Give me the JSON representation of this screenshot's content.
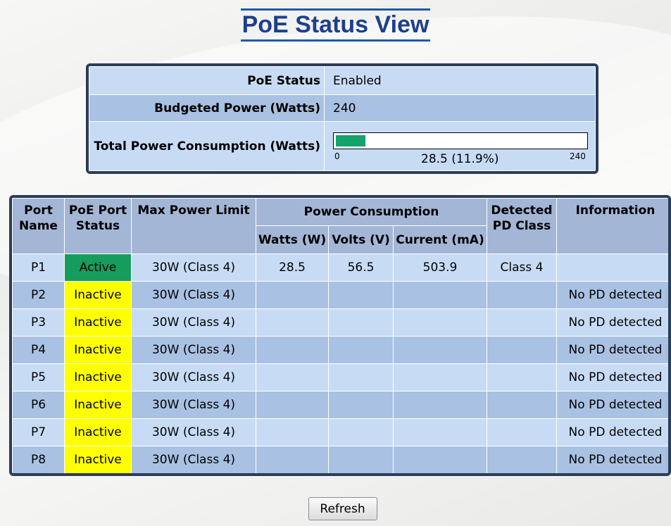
{
  "page": {
    "title": "PoE Status View"
  },
  "summary": {
    "poe_status_label": "PoE Status",
    "poe_status_value": "Enabled",
    "budget_label": "Budgeted Power (Watts)",
    "budget_value": "240",
    "consumption_label": "Total Power Consumption (Watts)",
    "bar_min": "0",
    "bar_max": "240",
    "bar_text": "28.5 (11.9%)",
    "bar_fraction": 0.119
  },
  "ports": {
    "headers": {
      "port_name": "Port Name",
      "poe_port_status": "PoE Port Status",
      "max_power_limit": "Max Power Limit",
      "power_consumption": "Power Consumption",
      "watts": "Watts (W)",
      "volts": "Volts (V)",
      "current": "Current (mA)",
      "detected_pd_class": "Detected PD Class",
      "information": "Information"
    },
    "rows": [
      {
        "port": "P1",
        "status": "Active",
        "limit": "30W (Class 4)",
        "watts": "28.5",
        "volts": "56.5",
        "current": "503.9",
        "pd_class": "Class 4",
        "info": ""
      },
      {
        "port": "P2",
        "status": "Inactive",
        "limit": "30W (Class 4)",
        "watts": "",
        "volts": "",
        "current": "",
        "pd_class": "",
        "info": "No PD detected"
      },
      {
        "port": "P3",
        "status": "Inactive",
        "limit": "30W (Class 4)",
        "watts": "",
        "volts": "",
        "current": "",
        "pd_class": "",
        "info": "No PD detected"
      },
      {
        "port": "P4",
        "status": "Inactive",
        "limit": "30W (Class 4)",
        "watts": "",
        "volts": "",
        "current": "",
        "pd_class": "",
        "info": "No PD detected"
      },
      {
        "port": "P5",
        "status": "Inactive",
        "limit": "30W (Class 4)",
        "watts": "",
        "volts": "",
        "current": "",
        "pd_class": "",
        "info": "No PD detected"
      },
      {
        "port": "P6",
        "status": "Inactive",
        "limit": "30W (Class 4)",
        "watts": "",
        "volts": "",
        "current": "",
        "pd_class": "",
        "info": "No PD detected"
      },
      {
        "port": "P7",
        "status": "Inactive",
        "limit": "30W (Class 4)",
        "watts": "",
        "volts": "",
        "current": "",
        "pd_class": "",
        "info": "No PD detected"
      },
      {
        "port": "P8",
        "status": "Inactive",
        "limit": "30W (Class 4)",
        "watts": "",
        "volts": "",
        "current": "",
        "pd_class": "",
        "info": "No PD detected"
      }
    ]
  },
  "refresh_label": "Refresh",
  "colors": {
    "title": "#1d3f8e",
    "active": "#169c5c",
    "inactive": "#ffff00",
    "bar_fill": "#14a36b",
    "border": "#2b3d57"
  }
}
